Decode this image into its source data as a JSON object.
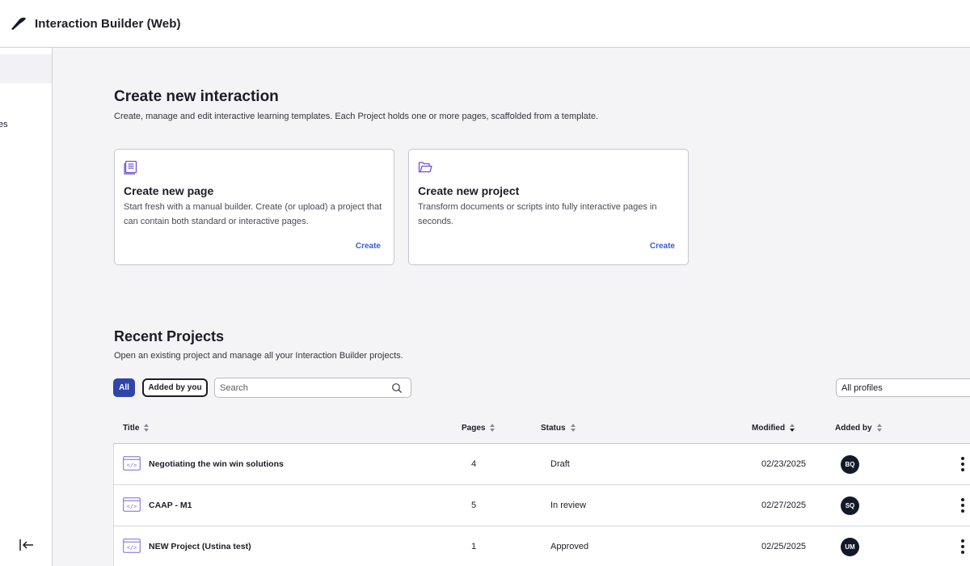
{
  "app": {
    "title": "Interaction Builder (Web)"
  },
  "sidebar": {
    "partial_label": "es"
  },
  "create_section": {
    "title": "Create new interaction",
    "description": "Create, manage and edit interactive learning templates. Each Project holds one or more pages, scaffolded from a template.",
    "cards": [
      {
        "title": "Create new page",
        "description": "Start fresh with a manual builder. Create (or upload) a project that can contain both standard or interactive pages.",
        "action": "Create",
        "icon": "document-lines-icon"
      },
      {
        "title": "Create new project",
        "description": "Transform documents or scripts into fully interactive pages in seconds.",
        "action": "Create",
        "icon": "folder-icon"
      }
    ]
  },
  "recent": {
    "title": "Recent Projects",
    "description": "Open an existing project and manage all your Interaction Builder projects.",
    "filters": {
      "all": "All",
      "added_by_you": "Added by you"
    },
    "search": {
      "placeholder": "Search",
      "value": ""
    },
    "profiles": "All profiles",
    "columns": {
      "title": "Title",
      "pages": "Pages",
      "status": "Status",
      "modified": "Modified",
      "added_by": "Added by"
    },
    "rows": [
      {
        "title": "Negotiating the win win solutions",
        "pages": "4",
        "status": "Draft",
        "modified": "02/23/2025",
        "initials": "BQ"
      },
      {
        "title": "CAAP - M1",
        "pages": "5",
        "status": "In review",
        "modified": "02/27/2025",
        "initials": "SQ"
      },
      {
        "title": "NEW Project (Ustina test)",
        "pages": "1",
        "status": "Approved",
        "modified": "02/25/2025",
        "initials": "UM"
      }
    ]
  },
  "colors": {
    "accent": "#2f45a8",
    "link": "#3b5bd6",
    "icon_purple": "#6b4fd8",
    "avatar_bg": "#121a2a"
  }
}
